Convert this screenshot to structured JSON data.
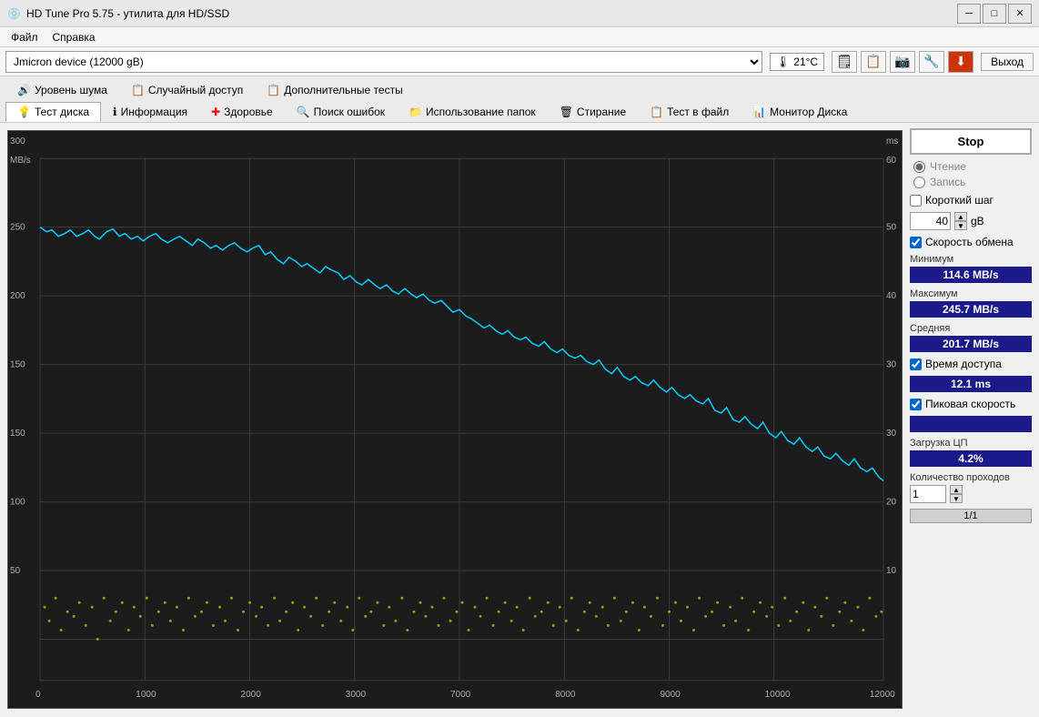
{
  "titleBar": {
    "icon": "💿",
    "title": "HD Tune Pro 5.75 - утилита для HD/SSD",
    "minBtn": "─",
    "maxBtn": "□",
    "closeBtn": "✕"
  },
  "menuBar": {
    "items": [
      "Файл",
      "Справка"
    ]
  },
  "deviceBar": {
    "deviceName": "Jmicron device (12000 gB)",
    "temperature": "21°C",
    "exitLabel": "Выход"
  },
  "toolbar": {
    "row1": [
      {
        "label": "Уровень шума",
        "icon": "🔊"
      },
      {
        "label": "Случайный доступ",
        "icon": "📋"
      },
      {
        "label": "Дополнительные тесты",
        "icon": "📋"
      }
    ],
    "row2": [
      {
        "label": "Тест диска",
        "icon": "💡",
        "active": true
      },
      {
        "label": "Информация",
        "icon": "ℹ"
      },
      {
        "label": "Здоровье",
        "icon": "➕"
      },
      {
        "label": "Поиск ошибок",
        "icon": "🔍"
      },
      {
        "label": "Использование папок",
        "icon": "📁"
      },
      {
        "label": "Стирание",
        "icon": "🗑"
      },
      {
        "label": "Тест в файл",
        "icon": "📋"
      },
      {
        "label": "Монитор Диска",
        "icon": "📊"
      }
    ]
  },
  "chart": {
    "yLabelLeft": "MB/s",
    "yLabelRight": "ms",
    "yMaxLeft": 300,
    "yMaxRight": 60,
    "yMidLeft": 250,
    "y50Right": 50,
    "y200Left": 200,
    "y40Right": 40,
    "y150Left": 150,
    "y30Right": 30,
    "y100Left": 100,
    "y20Right": 20,
    "y50Left": 50,
    "y10Right": 10
  },
  "rightPanel": {
    "stopBtn": "Stop",
    "readLabel": "Чтение",
    "writeLabel": "Запись",
    "shortStepLabel": "Короткий шаг",
    "stepValue": "40",
    "stepUnit": "gB",
    "transferRateLabel": "Скорость обмена",
    "minLabel": "Минимум",
    "minValue": "114.6 MB/s",
    "maxLabel": "Максимум",
    "maxValue": "245.7 MB/s",
    "avgLabel": "Средняя",
    "avgValue": "201.7 MB/s",
    "accessTimeLabel": "Время доступа",
    "accessTimeValue": "12.1 ms",
    "peakSpeedLabel": "Пиковая скорость",
    "peakSpeedValue": "",
    "cpuLabel": "Загрузка ЦП",
    "cpuValue": "4.2%",
    "passesLabel": "Количество проходов",
    "passesValue": "1",
    "progressLabel": "1/1"
  }
}
